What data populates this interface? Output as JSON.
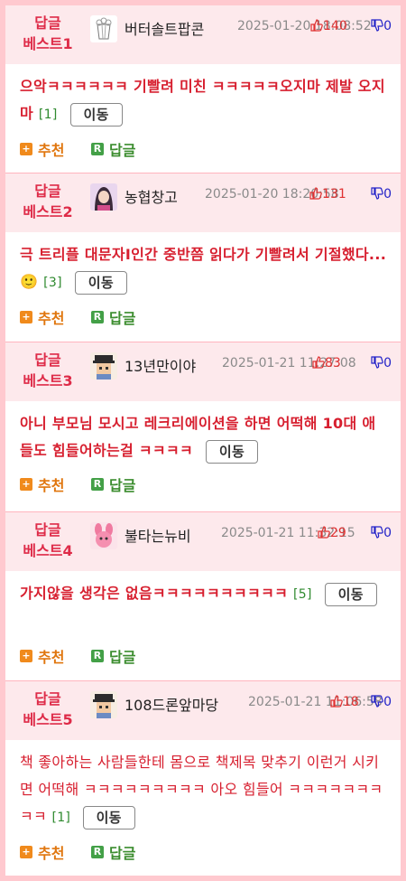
{
  "posts": [
    {
      "best_line1": "답글",
      "best_line2": "베스트1",
      "nick": "버터솔트팝콘",
      "date": "2025-01-20 18:08:52",
      "up": "140",
      "down": "0",
      "text": "으악ㅋㅋㅋㅋㅋㅋ 기빨려 미친 ㅋㅋㅋㅋㅋ오지마 제발 오지마",
      "count": "[1]",
      "move": "이동",
      "recommend": "추천",
      "reply": "답글",
      "avatar_icon": "popcorn-sketch-icon"
    },
    {
      "best_line1": "답글",
      "best_line2": "베스트2",
      "nick": "농협창고",
      "date": "2025-01-20 18:20:58",
      "up": "131",
      "down": "0",
      "text": "극 트리플 대문자I인간 중반쯤 읽다가 기빨려서 기절했다...🙂",
      "count": "[3]",
      "move": "이동",
      "recommend": "추천",
      "reply": "답글",
      "avatar_icon": "character-portrait-icon"
    },
    {
      "best_line1": "답글",
      "best_line2": "베스트3",
      "nick": "13년만이야",
      "date": "2025-01-21 11:27:08",
      "up": "83",
      "down": "0",
      "text": "아니 부모님 모시고 레크리에이션을 하면 어떡해 10대 애들도 힘들어하는걸 ㅋㅋㅋㅋ",
      "count": "",
      "move": "이동",
      "recommend": "추천",
      "reply": "답글",
      "avatar_icon": "pixel-character-icon"
    },
    {
      "best_line1": "답글",
      "best_line2": "베스트4",
      "nick": "불타는뉴비",
      "date": "2025-01-21 11:32:15",
      "up": "29",
      "down": "0",
      "text": "가지않을 생각은 없음ㅋㅋㅋㅋㅋㅋㅋㅋㅋㅋ",
      "count": "[5]",
      "move": "이동",
      "recommend": "추천",
      "reply": "답글",
      "avatar_icon": "pink-bunny-icon"
    },
    {
      "best_line1": "답글",
      "best_line2": "베스트5",
      "nick": "108드론앞마당",
      "date": "2025-01-21 11:06:58",
      "up": "18",
      "down": "0",
      "text": "책 좋아하는 사람들한테 몸으로 책제목 맞추기 이런거 시키면 어떡해 ㅋㅋㅋㅋㅋㅋㅋㅋㅋ 아오 힘들어 ㅋㅋㅋㅋㅋㅋㅋㅋㅋ",
      "count": "[1]",
      "move": "이동",
      "recommend": "추천",
      "reply": "답글",
      "avatar_icon": "pixel-character-icon"
    }
  ],
  "colors": {
    "accent": "#de2b48",
    "header_bg": "#fde9ec",
    "page_border": "#ffc9cf",
    "recommend": "#f08a1c",
    "reply": "#43a047"
  }
}
